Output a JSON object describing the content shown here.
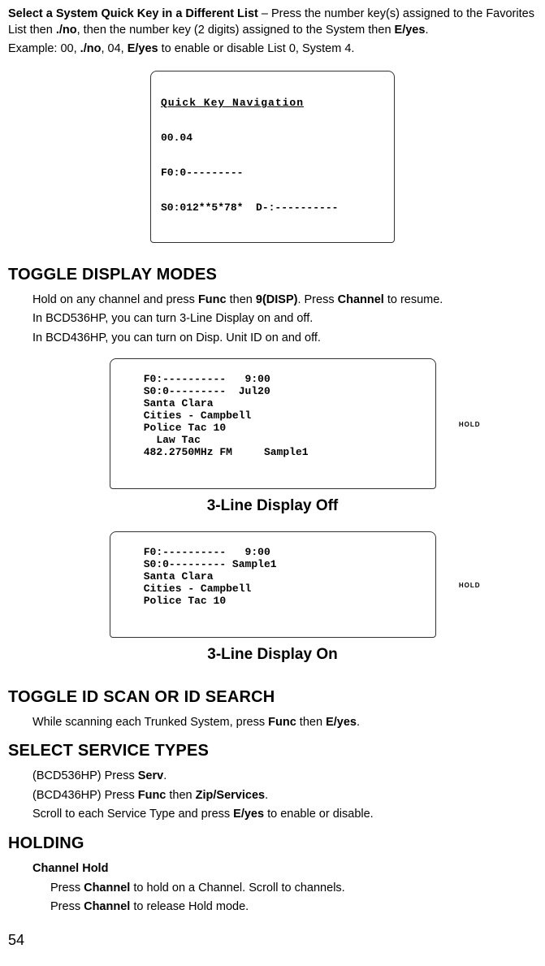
{
  "intro": {
    "lead_bold": "Select a System Quick Key in a Different List",
    "lead_rest": " – Press the number key(s) assigned to the Favorites List then ",
    "bold1": "./no",
    "mid": ", then the number key (2 digits) assigned to the System then ",
    "bold2": "E/yes",
    "end": ".",
    "example_pre": "Example: 00, ",
    "example_b1": "./no",
    "example_mid": ", 04, ",
    "example_b2": "E/yes",
    "example_end": " to enable or disable List 0, System 4."
  },
  "lcd1": {
    "title": "Quick Key Navigation",
    "l1": "00.04",
    "l2": "F0:0---------",
    "l3": "S0:012**5*78*  D-:----------"
  },
  "sections": {
    "toggle_display": {
      "heading": "TOGGLE DISPLAY MODES",
      "p1_a": "Hold on any channel and press ",
      "p1_b1": "Func",
      "p1_mid": " then ",
      "p1_b2": "9(DISP)",
      "p1_mid2": ". Press ",
      "p1_b3": "Channel",
      "p1_end": " to resume.",
      "p2": "In BCD536HP, you can turn 3-Line Display on and off.",
      "p3": "In BCD436HP, you can turn on Disp. Unit ID on and off."
    },
    "caption_off": "3-Line Display Off",
    "caption_on": "3-Line Display On",
    "toggle_id": {
      "heading": "TOGGLE ID SCAN OR ID SEARCH",
      "p1_a": "While scanning each Trunked System, press ",
      "p1_b1": "Func",
      "p1_mid": " then ",
      "p1_b2": "E/yes",
      "p1_end": "."
    },
    "service_types": {
      "heading": "SELECT SERVICE TYPES",
      "p1_a": "(BCD536HP) Press ",
      "p1_b1": "Serv",
      "p1_end": ".",
      "p2_a": "(BCD436HP) Press ",
      "p2_b1": "Func",
      "p2_mid": " then ",
      "p2_b2": "Zip/Services",
      "p2_end": ".",
      "p3_a": "Scroll to each Service Type and press ",
      "p3_b1": "E/yes",
      "p3_end": " to enable or disable."
    },
    "holding": {
      "heading": "HOLDING",
      "sub": "Channel Hold",
      "p1_a": "Press ",
      "p1_b1": "Channel",
      "p1_end": " to hold on a Channel. Scroll to channels.",
      "p2_a": "Press ",
      "p2_b1": "Channel",
      "p2_end": " to release Hold mode."
    }
  },
  "lcd_off": {
    "l1": "F0:----------   9:00",
    "l2": "S0:0---------  Jul20",
    "l3": "Santa Clara",
    "l4": "Cities - Campbell",
    "big": "Police Tac 10",
    "l6": "  Law Tac",
    "l7": "482.2750MHz FM     Sample1",
    "hold": "HOLD"
  },
  "lcd_on": {
    "l1": "F0:----------   9:00",
    "l2": "S0:0--------- Sample1",
    "b1": "Santa Clara",
    "b2": "Cities - Campbell",
    "b3": "Police Tac 10",
    "hold": "HOLD"
  },
  "pagenum": "54"
}
